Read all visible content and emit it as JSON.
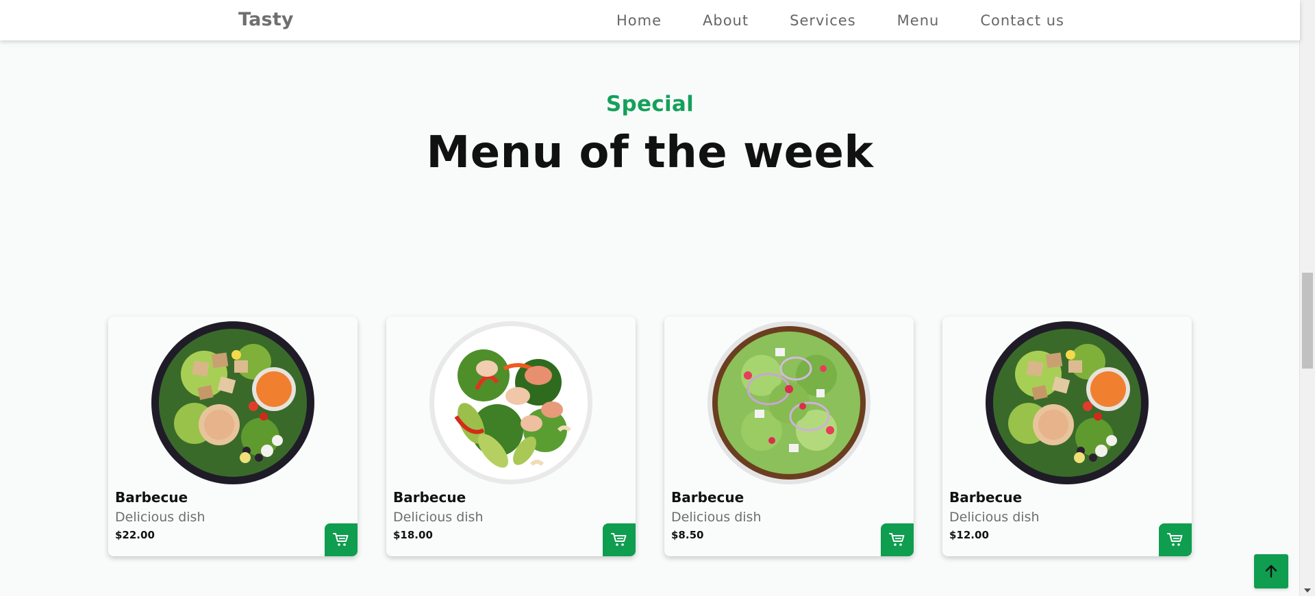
{
  "header": {
    "brand": "Tasty",
    "nav": [
      {
        "label": "Home"
      },
      {
        "label": "About"
      },
      {
        "label": "Services"
      },
      {
        "label": "Menu"
      },
      {
        "label": "Contact us"
      }
    ]
  },
  "section": {
    "subtitle": "Special",
    "title": "Menu of the week"
  },
  "cards": [
    {
      "name": "Barbecue",
      "description": "Delicious dish",
      "price": "$22.00",
      "image": "chicken-salad-bowl"
    },
    {
      "name": "Barbecue",
      "description": "Delicious dish",
      "price": "$18.00",
      "image": "avocado-chicken-salad"
    },
    {
      "name": "Barbecue",
      "description": "Delicious dish",
      "price": "$8.50",
      "image": "green-salad-onion"
    },
    {
      "name": "Barbecue",
      "description": "Delicious dish",
      "price": "$12.00",
      "image": "chicken-salad-bowl"
    }
  ],
  "icons": {
    "cart": "cart-icon",
    "back_to_top": "arrow-up-icon"
  },
  "colors": {
    "accent": "#0f9d4f",
    "subtitle": "#16a05a",
    "title": "#111111",
    "nav": "#666666"
  }
}
